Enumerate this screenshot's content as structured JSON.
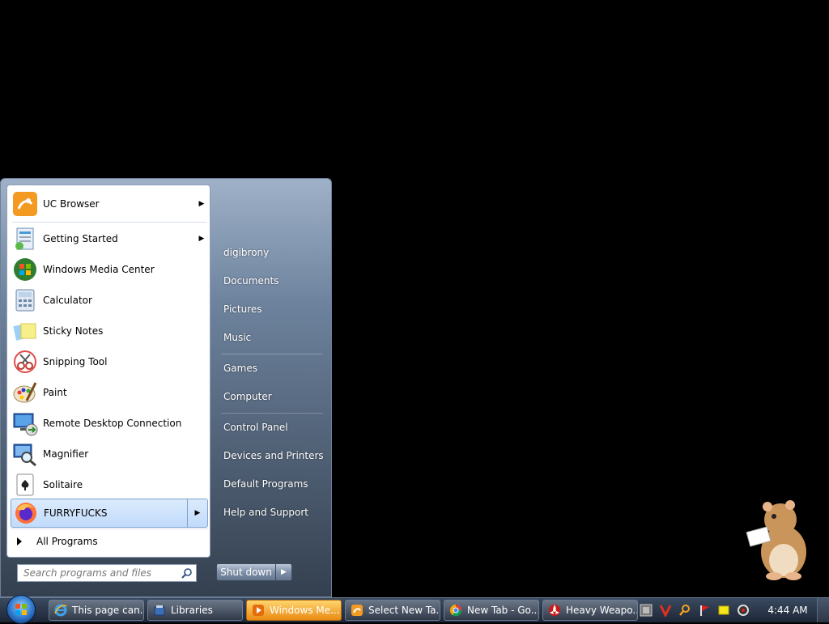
{
  "start_menu": {
    "programs": [
      {
        "label": "UC Browser",
        "icon": "uc-browser-icon",
        "arrow": "▶"
      },
      {
        "label": "Getting Started",
        "icon": "getting-started-icon",
        "arrow": "▶"
      },
      {
        "label": "Windows Media Center",
        "icon": "windows-media-center-icon",
        "arrow": ""
      },
      {
        "label": "Calculator",
        "icon": "calculator-icon",
        "arrow": ""
      },
      {
        "label": "Sticky Notes",
        "icon": "sticky-notes-icon",
        "arrow": ""
      },
      {
        "label": "Snipping Tool",
        "icon": "snipping-tool-icon",
        "arrow": ""
      },
      {
        "label": "Paint",
        "icon": "paint-icon",
        "arrow": ""
      },
      {
        "label": "Remote Desktop Connection",
        "icon": "remote-desktop-icon",
        "arrow": ""
      },
      {
        "label": "Magnifier",
        "icon": "magnifier-icon",
        "arrow": ""
      },
      {
        "label": "Solitaire",
        "icon": "solitaire-icon",
        "arrow": ""
      },
      {
        "label": "FURRYFUCKS",
        "icon": "firefox-icon",
        "arrow": "▶"
      }
    ],
    "all_programs_label": "All Programs",
    "search_placeholder": "Search programs and files",
    "right_items": [
      "digibrony",
      "Documents",
      "Pictures",
      "Music",
      "Games",
      "Computer",
      "Control Panel",
      "Devices and Printers",
      "Default Programs",
      "Help and Support"
    ],
    "shutdown_label": "Shut down",
    "shutdown_arrow": "▶"
  },
  "taskbar": {
    "items": [
      {
        "label": "This page can...",
        "icon": "internet-explorer-icon",
        "active": false
      },
      {
        "label": "Libraries",
        "icon": "libraries-icon",
        "active": false
      },
      {
        "label": "Windows Me...",
        "icon": "windows-media-icon",
        "active": true
      },
      {
        "label": "Select New Ta...",
        "icon": "uc-browser-icon",
        "active": false
      },
      {
        "label": "New Tab - Go...",
        "icon": "chrome-icon",
        "active": false
      },
      {
        "label": "Heavy Weapo...",
        "icon": "heavy-weapon-icon",
        "active": false
      }
    ],
    "tray_icons": [
      "tray-app-icon",
      "vivaldi-icon",
      "search-tray-icon",
      "flag-icon",
      "notes-tray-icon",
      "network-icon"
    ],
    "clock": "4:44 AM"
  },
  "colors": {
    "accent_orange": "#e98b13",
    "highlight_blue": "#c1dbfb"
  }
}
